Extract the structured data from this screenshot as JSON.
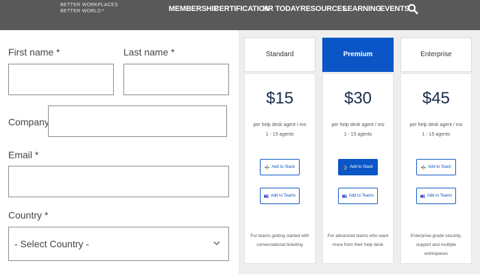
{
  "header": {
    "brand_line1": "BETTER WORKPLACES",
    "brand_line2": "BETTER WORLD",
    "brand_tm": "™",
    "nav": [
      "MEMBERSHIP",
      "CERTIFICATION",
      "HR TODAY",
      "RESOURCES",
      "LEARNING",
      "EVENTS"
    ],
    "search_icon": "search-icon"
  },
  "form": {
    "first_name_label": "First name *",
    "first_name_value": "",
    "last_name_label": "Last name *",
    "last_name_value": "",
    "company_label": "Company *",
    "company_value": "",
    "email_label": "Email *",
    "email_value": "",
    "country_label": "Country *",
    "country_selected": "- Select Country -"
  },
  "plans": [
    {
      "name": "Standard",
      "price": "$15",
      "per": "per help desk agent / mo",
      "agents": "1 - 15 agents",
      "slack_label": "Add to Slack",
      "teams_label": "Add to Teams",
      "description": "For teams getting started with conversational ticketing",
      "highlighted": false
    },
    {
      "name": "Premium",
      "price": "$30",
      "per": "per help desk agent / mo",
      "agents": "1 - 15 agents",
      "slack_label": "Add to Slack",
      "teams_label": "Add to Teams",
      "description": "For advanced teams who want more from their help desk",
      "highlighted": true
    },
    {
      "name": "Enterprise",
      "price": "$45",
      "per": "per help desk agent / mo",
      "agents": "1 - 15 agents",
      "slack_label": "Add to Slack",
      "teams_label": "Add to Teams",
      "description": "Enterprise-grade security, support and multiple workspaces",
      "highlighted": false
    }
  ],
  "colors": {
    "nav_bg": "#595959",
    "accent": "#0b56c6",
    "price_text": "#1a2b4c",
    "panel_bg": "#eeeeee"
  }
}
